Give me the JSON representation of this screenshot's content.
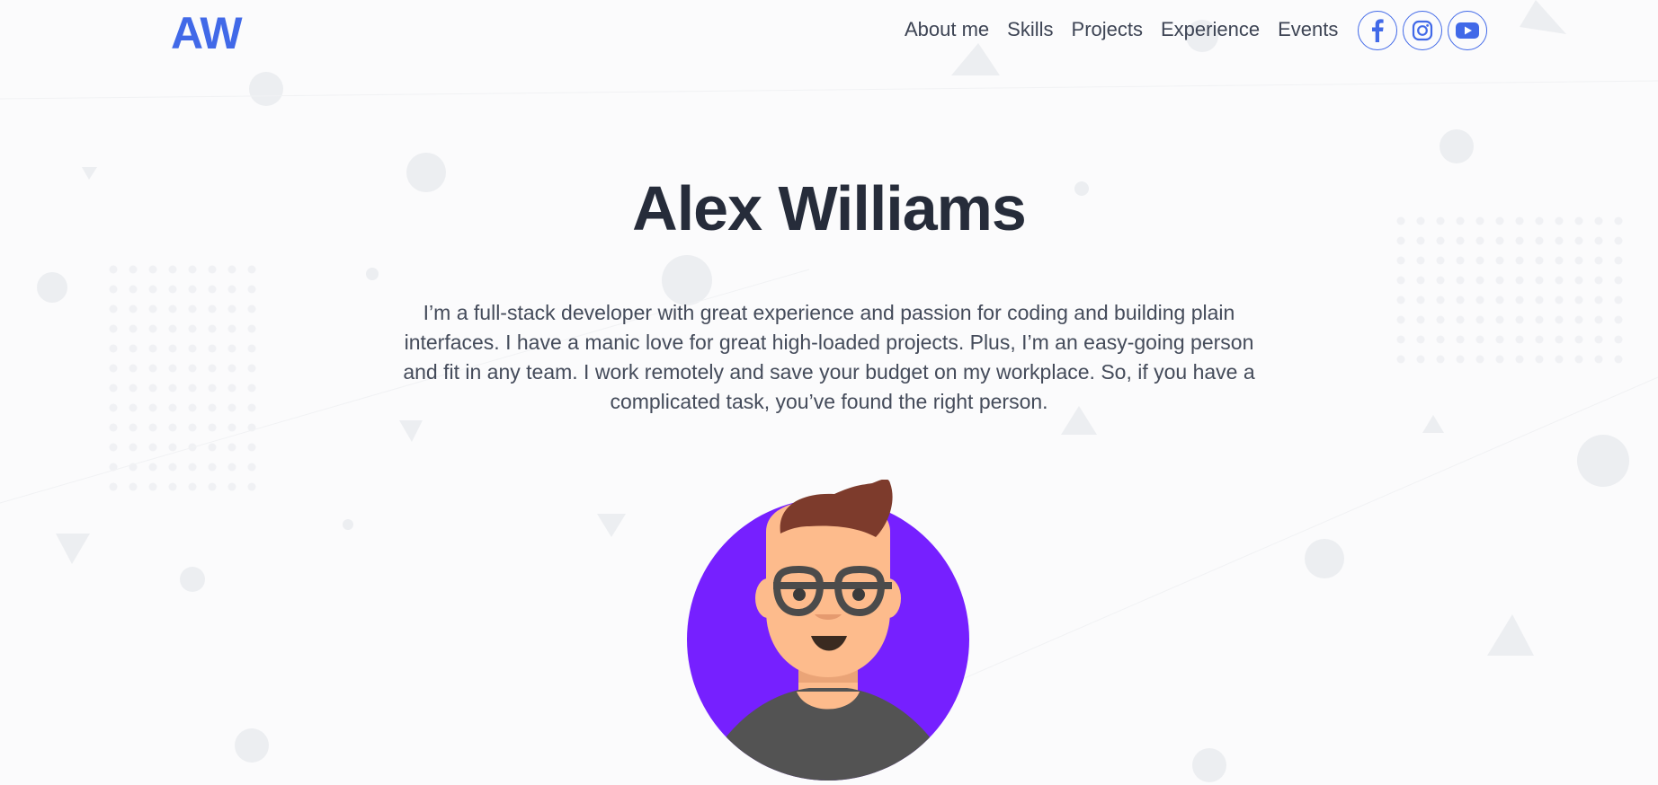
{
  "logo": "AW",
  "nav": {
    "items": [
      "About me",
      "Skills",
      "Projects",
      "Experience",
      "Events"
    ]
  },
  "socials": [
    {
      "icon": "facebook-icon"
    },
    {
      "icon": "instagram-icon"
    },
    {
      "icon": "youtube-icon"
    }
  ],
  "hero": {
    "name": "Alex Williams",
    "bio": "I’m a full-stack developer with great experience and passion for coding and building plain interfaces. I have a manic love for great high-loaded projects. Plus, I’m an easy-going person and fit in any team. I work remotely and save your budget on my workplace. So, if you have a complicated task, you’ve found the right person."
  },
  "colors": {
    "accent": "#4169e8",
    "avatar_bg": "#7620ff",
    "hair": "#7d3b2c",
    "skin": "#fdbb8c",
    "shirt": "#535353"
  }
}
